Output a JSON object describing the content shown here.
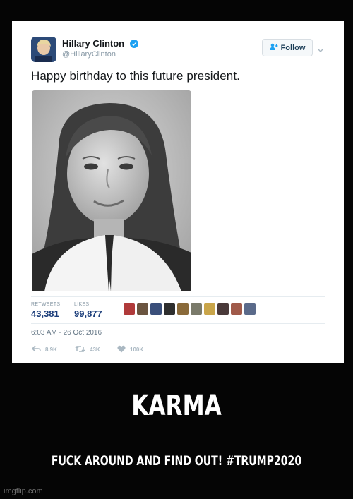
{
  "tweet": {
    "author_name": "Hillary Clinton",
    "author_handle": "@HillaryClinton",
    "follow_label": "Follow",
    "text": "Happy birthday to this future president.",
    "stats": {
      "retweets_label": "RETWEETS",
      "retweets_value": "43,381",
      "likes_label": "LIKES",
      "likes_value": "99,877"
    },
    "timestamp": "6:03 AM - 26 Oct 2016",
    "actions": {
      "replies": "8.9K",
      "retweets": "43K",
      "likes": "100K"
    }
  },
  "meme": {
    "headline": "KARMA",
    "subline": "FUCK AROUND AND FIND OUT! #TRUMP2020"
  },
  "watermark": "imgflip.com",
  "colors": {
    "background": "#050505",
    "card": "#ffffff",
    "verified": "#1da1f2",
    "stat_value": "#1b3d7a"
  },
  "icons": [
    "verified-badge-icon",
    "add-user-icon",
    "chevron-down-icon",
    "reply-icon",
    "retweet-icon",
    "heart-icon"
  ]
}
